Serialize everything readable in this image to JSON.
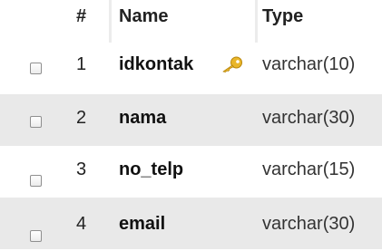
{
  "columns": {
    "num": "#",
    "name": "Name",
    "type": "Type"
  },
  "rows": [
    {
      "num": "1",
      "name": "idkontak",
      "type": "varchar(10)",
      "primary_key": true
    },
    {
      "num": "2",
      "name": "nama",
      "type": "varchar(30)",
      "primary_key": false
    },
    {
      "num": "3",
      "name": "no_telp",
      "type": "varchar(15)",
      "primary_key": false
    },
    {
      "num": "4",
      "name": "email",
      "type": "varchar(30)",
      "primary_key": false
    }
  ],
  "icons": {
    "primary_key": "key-icon"
  },
  "colors": {
    "even_row_bg": "#e9e9e9",
    "key_gold": "#e9b62a"
  }
}
